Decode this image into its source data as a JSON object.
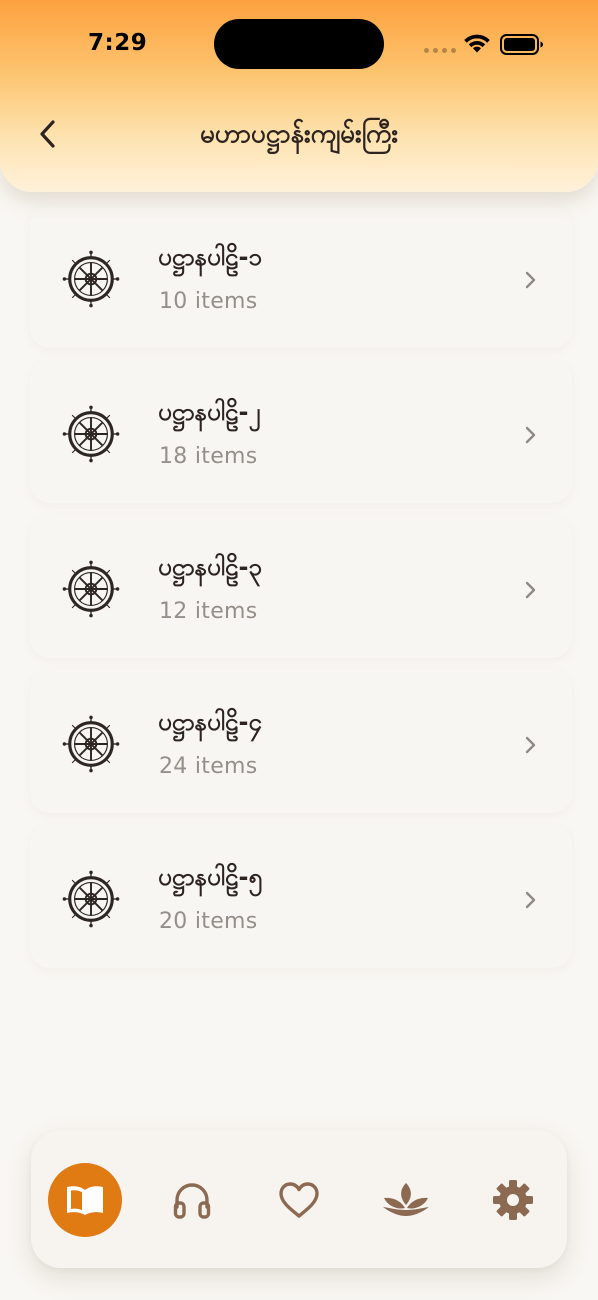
{
  "status": {
    "time": "7:29"
  },
  "header": {
    "title": "မဟာပဋ္ဌာန်းကျမ်းကြီး",
    "back_icon": "chevron-left-icon"
  },
  "sections": [
    {
      "title": "ပဋ္ဌာနပါဠိ-၁",
      "count": "10 items"
    },
    {
      "title": "ပဋ္ဌာနပါဠိ-၂",
      "count": "18 items"
    },
    {
      "title": "ပဋ္ဌာနပါဠိ-၃",
      "count": "12 items"
    },
    {
      "title": "ပဋ္ဌာနပါဠိ-၄",
      "count": "24 items"
    },
    {
      "title": "ပဋ္ဌာနပါဠိ-၅",
      "count": "20 items"
    }
  ],
  "tabs": [
    {
      "icon": "book-icon",
      "active": true
    },
    {
      "icon": "headphones-icon",
      "active": false
    },
    {
      "icon": "heart-icon",
      "active": false
    },
    {
      "icon": "lotus-icon",
      "active": false
    },
    {
      "icon": "gear-icon",
      "active": false
    }
  ],
  "colors": {
    "accent": "#e07b14",
    "header_top": "#fda13f",
    "header_bottom": "#fef1da",
    "background": "#f9f7f3",
    "icon_brown": "#8c6a52",
    "title_text": "#2d2320",
    "secondary_text": "#958f8a"
  }
}
